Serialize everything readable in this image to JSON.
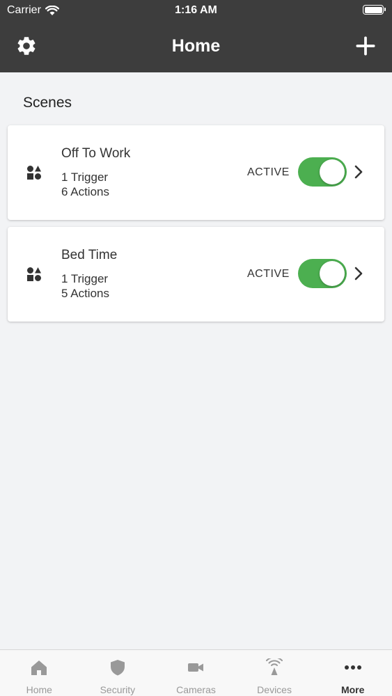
{
  "status_bar": {
    "carrier": "Carrier",
    "time": "1:16 AM"
  },
  "nav": {
    "title": "Home",
    "left_icon": "gear-icon",
    "right_icon": "plus-icon"
  },
  "scenes": {
    "title": "Scenes",
    "items": [
      {
        "name": "Off To Work",
        "triggers": "1 Trigger",
        "actions": "6 Actions",
        "status": "ACTIVE",
        "enabled": true
      },
      {
        "name": "Bed Time",
        "triggers": "1 Trigger",
        "actions": "5 Actions",
        "status": "ACTIVE",
        "enabled": true
      }
    ]
  },
  "tabs": [
    {
      "label": "Home",
      "icon": "home-icon",
      "active": false
    },
    {
      "label": "Security",
      "icon": "shield-icon",
      "active": false
    },
    {
      "label": "Cameras",
      "icon": "camera-icon",
      "active": false
    },
    {
      "label": "Devices",
      "icon": "wifi-antenna-icon",
      "active": false
    },
    {
      "label": "More",
      "icon": "more-dots-icon",
      "active": true
    }
  ],
  "colors": {
    "header_bg": "#3d3d3d",
    "toggle_on": "#4caf50",
    "tab_inactive": "#999999",
    "tab_active": "#333333"
  }
}
